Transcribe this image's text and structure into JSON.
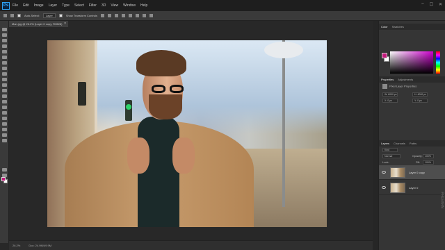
{
  "app": {
    "logo": "Ps"
  },
  "menu": [
    "File",
    "Edit",
    "Image",
    "Layer",
    "Type",
    "Select",
    "Filter",
    "3D",
    "View",
    "Window",
    "Help"
  ],
  "window_controls": [
    "–",
    "☐",
    "✕"
  ],
  "options": {
    "auto_select_label": "Auto-Select:",
    "auto_select_value": "Layer",
    "show_transform_label": "Show Transform Controls"
  },
  "document_tab": {
    "title": "Man.jpg @ 26.2% (Layer 0 copy, RGB/8)",
    "close": "×"
  },
  "status": {
    "zoom": "26.2%",
    "doc_size": "Doc: 24.9M/49.9M"
  },
  "color_panel": {
    "tabs": [
      "Color",
      "Swatches"
    ],
    "fg": "#c3197c",
    "bg": "#ffffff"
  },
  "properties_panel": {
    "tabs": [
      "Properties",
      "Adjustments"
    ],
    "section": "Pixel Layer Properties",
    "w": "W: 6000 px",
    "h": "H: 4000 px",
    "x": "X: 0 px",
    "y": "Y: 0 px"
  },
  "layers_panel": {
    "tabs": [
      "Layers",
      "Channels",
      "Paths"
    ],
    "filter_kind": "Kind",
    "blend_mode": "Normal",
    "opacity_label": "Opacity:",
    "opacity_value": "100%",
    "lock_label": "Lock:",
    "fill_label": "Fill:",
    "fill_value": "100%",
    "layers": [
      {
        "name": "Layer 0 copy",
        "selected": true
      },
      {
        "name": "Layer 0",
        "selected": false
      }
    ]
  },
  "watermark": "PHLEARN"
}
